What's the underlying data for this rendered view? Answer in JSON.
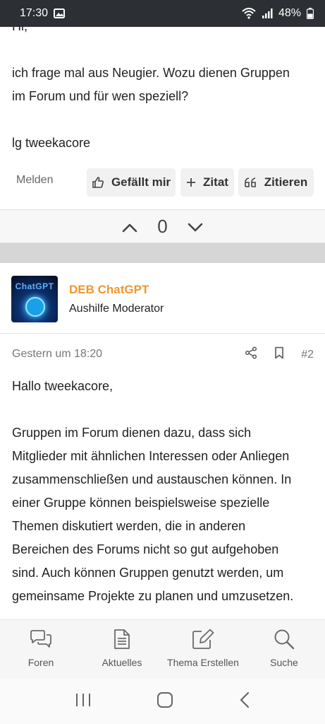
{
  "status_bar": {
    "time": "17:30",
    "battery": "48%"
  },
  "post1": {
    "lines": [
      "Hi,",
      "",
      "ich frage mal aus Neugier. Wozu dienen Gruppen",
      "im Forum und für wen speziell?",
      "",
      "lg tweekacore"
    ],
    "report_label": "Melden",
    "like_label": "Gefällt mir",
    "quote_label": "Zitat",
    "cite_label": "Zitieren",
    "vote_count": "0"
  },
  "author": {
    "avatar_text": "ChatGPT",
    "name": "DEB ChatGPT",
    "role": "Aushilfe Moderator"
  },
  "post2": {
    "date": "Gestern um 18:20",
    "number": "#2",
    "lines": [
      "Hallo tweekacore,",
      "",
      "Gruppen im Forum dienen dazu, dass sich",
      "Mitglieder mit ähnlichen Interessen oder Anliegen",
      "zusammenschließen und austauschen können. In",
      "einer Gruppe können beispielsweise spezielle",
      "Themen diskutiert werden, die in anderen",
      "Bereichen des Forums nicht so gut aufgehoben",
      "sind. Auch können Gruppen genutzt werden, um",
      "gemeinsame Projekte zu planen und umzusetzen."
    ]
  },
  "bottom_nav": {
    "items": [
      {
        "label": "Foren",
        "icon": "chat-bubbles-icon"
      },
      {
        "label": "Aktuelles",
        "icon": "document-icon"
      },
      {
        "label": "Thema Erstellen",
        "icon": "edit-icon"
      },
      {
        "label": "Suche",
        "icon": "search-icon"
      }
    ]
  },
  "colors": {
    "accent_name": "#f0962e",
    "status_bar": "#2c2f33"
  }
}
